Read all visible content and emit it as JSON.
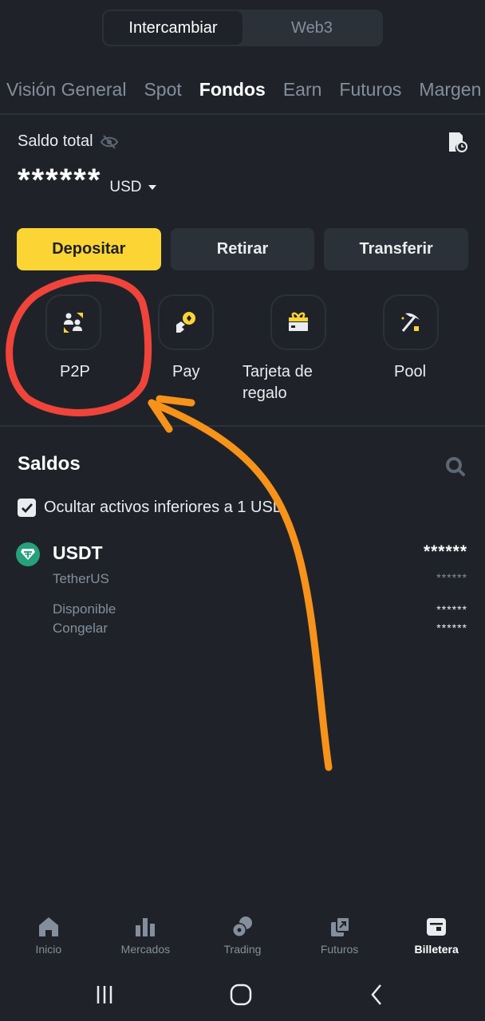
{
  "segment": {
    "items": [
      {
        "label": "Intercambiar",
        "active": true
      },
      {
        "label": "Web3",
        "active": false
      }
    ]
  },
  "tabs": [
    {
      "label": "Visión General",
      "active": false
    },
    {
      "label": "Spot",
      "active": false
    },
    {
      "label": "Fondos",
      "active": true
    },
    {
      "label": "Earn",
      "active": false
    },
    {
      "label": "Futuros",
      "active": false
    },
    {
      "label": "Margen",
      "active": false
    }
  ],
  "balance": {
    "label": "Saldo total",
    "value": "******",
    "currency": "USD"
  },
  "actions": {
    "deposit": "Depositar",
    "withdraw": "Retirar",
    "transfer": "Transferir"
  },
  "shortcuts": [
    {
      "label": "P2P",
      "icon": "p2p-icon"
    },
    {
      "label": "Pay",
      "icon": "pay-icon"
    },
    {
      "label": "Tarjeta de regalo",
      "icon": "gift-card-icon"
    },
    {
      "label": "Pool",
      "icon": "pickaxe-icon"
    }
  ],
  "saldos": {
    "title": "Saldos",
    "hide_small_label": "Ocultar activos inferiores a 1 USD",
    "hide_small_checked": true
  },
  "assets": [
    {
      "symbol": "USDT",
      "name": "TetherUS",
      "amount": "******",
      "usd_value": "******",
      "available_label": "Disponible",
      "available": "******",
      "frozen_label": "Congelar",
      "frozen": "******"
    }
  ],
  "bottom_nav": [
    {
      "label": "Inicio",
      "icon": "home-icon",
      "active": false
    },
    {
      "label": "Mercados",
      "icon": "markets-icon",
      "active": false
    },
    {
      "label": "Trading",
      "icon": "trading-icon",
      "active": false
    },
    {
      "label": "Futuros",
      "icon": "futures-icon",
      "active": false
    },
    {
      "label": "Billetera",
      "icon": "wallet-icon",
      "active": true
    }
  ],
  "colors": {
    "background": "#1f2329",
    "surface": "#2b3139",
    "accent_yellow": "#fcd535",
    "text_primary": "#eaecef",
    "text_secondary": "#848e9c",
    "tether_green": "#26a17b",
    "annotation_circle": "#f0443a",
    "annotation_arrow": "#f7931a"
  }
}
